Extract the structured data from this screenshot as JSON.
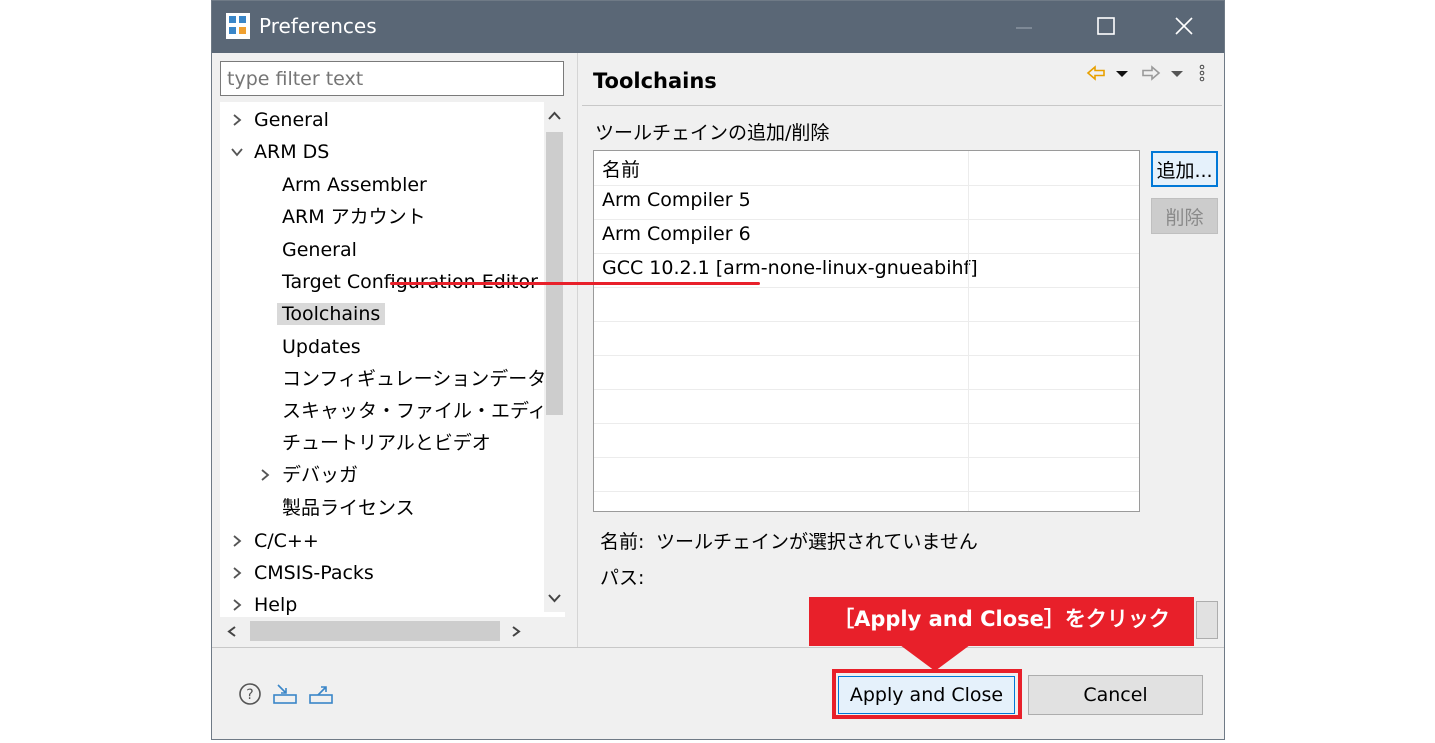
{
  "window": {
    "title": "Preferences"
  },
  "filter": {
    "placeholder": "type filter text"
  },
  "tree": {
    "items": [
      {
        "label": "General"
      },
      {
        "label": "ARM DS"
      },
      {
        "label": "Arm Assembler"
      },
      {
        "label": "ARM アカウント"
      },
      {
        "label": "General"
      },
      {
        "label": "Target Configuration Editor"
      },
      {
        "label": "Toolchains"
      },
      {
        "label": "Updates"
      },
      {
        "label": "コンフィギュレーションデータベース"
      },
      {
        "label": "スキャッタ・ファイル・エディタ"
      },
      {
        "label": "チュートリアルとビデオ"
      },
      {
        "label": "デバッガ"
      },
      {
        "label": "製品ライセンス"
      },
      {
        "label": "C/C++"
      },
      {
        "label": "CMSIS-Packs"
      },
      {
        "label": "Help"
      }
    ]
  },
  "page": {
    "title": "Toolchains",
    "section_label": "ツールチェインの追加/削除",
    "table": {
      "header": "名前",
      "rows": [
        "Arm Compiler 5",
        "Arm Compiler 6",
        "GCC 10.2.1 [arm-none-linux-gnueabihf]"
      ]
    },
    "add_label": "追加...",
    "remove_label": "削除",
    "name_label": "名前:",
    "name_value": "ツールチェインが選択されていません",
    "path_label": "パス:"
  },
  "footer": {
    "apply_close_label": "Apply and Close",
    "cancel_label": "Cancel"
  },
  "annotation": {
    "callout_text": "［Apply and Close］をクリック",
    "color": "#e8202a"
  },
  "colors": {
    "titlebar": "#5a6776",
    "accent": "#0078d7",
    "nav_arrow": "#e8a000"
  }
}
